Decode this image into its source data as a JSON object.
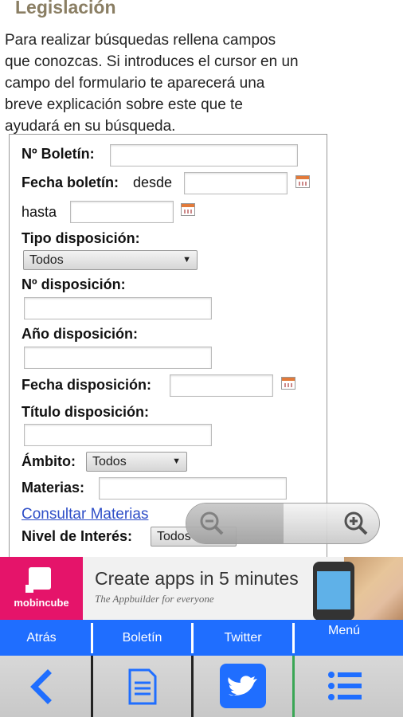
{
  "header": {
    "title": "Legislación"
  },
  "intro": {
    "lines": [
      "Para realizar búsquedas rellena campos",
      "que conozcas. Si introduces el cursor en un",
      "campo del formulario te aparecerá una",
      "breve explicación sobre este que te",
      "ayudará en su búsqueda."
    ]
  },
  "form": {
    "boletin_label": "Nº Boletín:",
    "fecha_boletin_label": "Fecha boletín:",
    "desde": "desde",
    "hasta": "hasta",
    "tipo_label": "Tipo disposición:",
    "tipo_value": "Todos",
    "num_disp_label": "Nº disposición:",
    "anio_disp_label": "Año disposición:",
    "fecha_disp_label": "Fecha disposición:",
    "titulo_disp_label": "Título disposición:",
    "ambito_label": "Ámbito:",
    "ambito_value": "Todos",
    "materias_label": "Materias:",
    "consultar_link": "Consultar Materias",
    "nivel_label": "Nivel de Interés:",
    "nivel_value": "Todos"
  },
  "ad": {
    "brand": "mobincube",
    "headline": "Create apps in 5 minutes",
    "subline": "The Appbuilder for everyone"
  },
  "tabs": [
    "Atrás",
    "Boletín",
    "Twitter",
    "Menú"
  ],
  "colors": {
    "tab_bar": "#1f6eff",
    "title": "#8a7e63",
    "ad_brand": "#e5146a",
    "twitter": "#1f6eff"
  },
  "icons": {
    "back": "chevron-left-icon",
    "doc": "document-icon",
    "twitter": "twitter-icon",
    "menu": "list-icon"
  }
}
